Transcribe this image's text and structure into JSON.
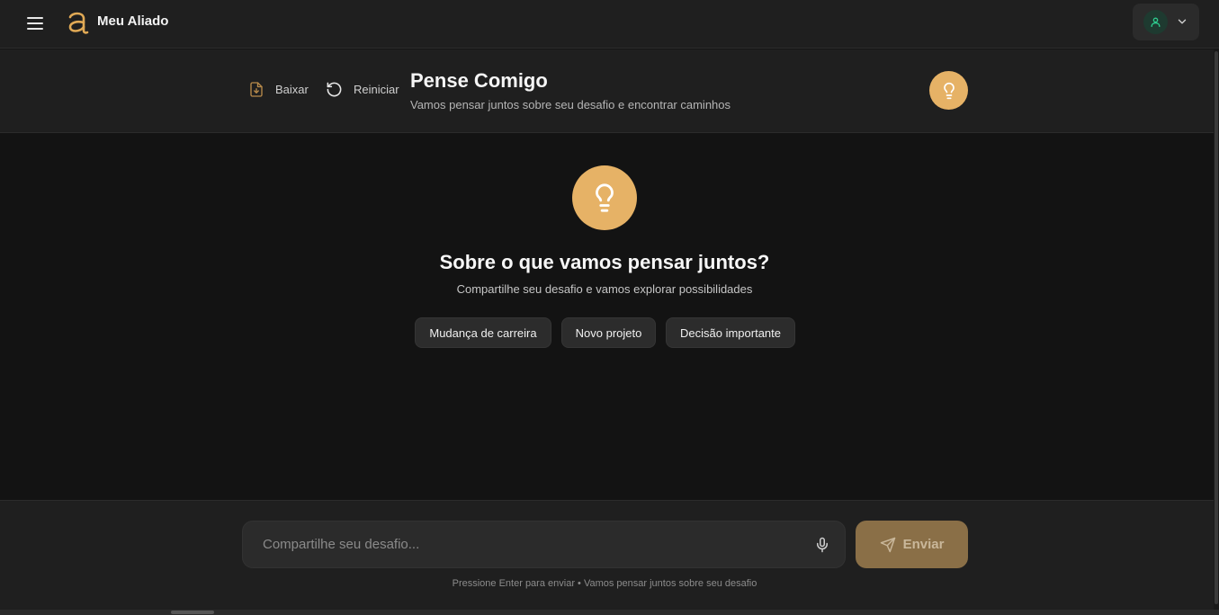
{
  "app": {
    "name": "Meu Aliado"
  },
  "header": {
    "download_label": "Baixar",
    "restart_label": "Reiniciar",
    "title": "Pense Comigo",
    "subtitle": "Vamos pensar juntos sobre seu desafio e encontrar caminhos"
  },
  "main": {
    "question": "Sobre o que vamos pensar juntos?",
    "prompt": "Compartilhe seu desafio e vamos explorar possibilidades",
    "suggestions": [
      "Mudança de carreira",
      "Novo projeto",
      "Decisão importante"
    ]
  },
  "composer": {
    "placeholder": "Compartilhe seu desafio...",
    "send_label": "Enviar",
    "hint": "Pressione Enter para enviar • Vamos pensar juntos sobre seu desafio"
  },
  "colors": {
    "accent": "#e6b266",
    "send_button": "#8a6f47",
    "avatar_icon": "#2ecc8f"
  },
  "icons": {
    "menu": "hamburger-icon",
    "logo": "letter-a-logo",
    "user": "user-icon",
    "dropdown": "chevron-down-icon",
    "download": "file-download-icon",
    "restart": "rotate-ccw-icon",
    "idea": "lightbulb-icon",
    "mic": "microphone-icon",
    "send": "send-icon"
  }
}
